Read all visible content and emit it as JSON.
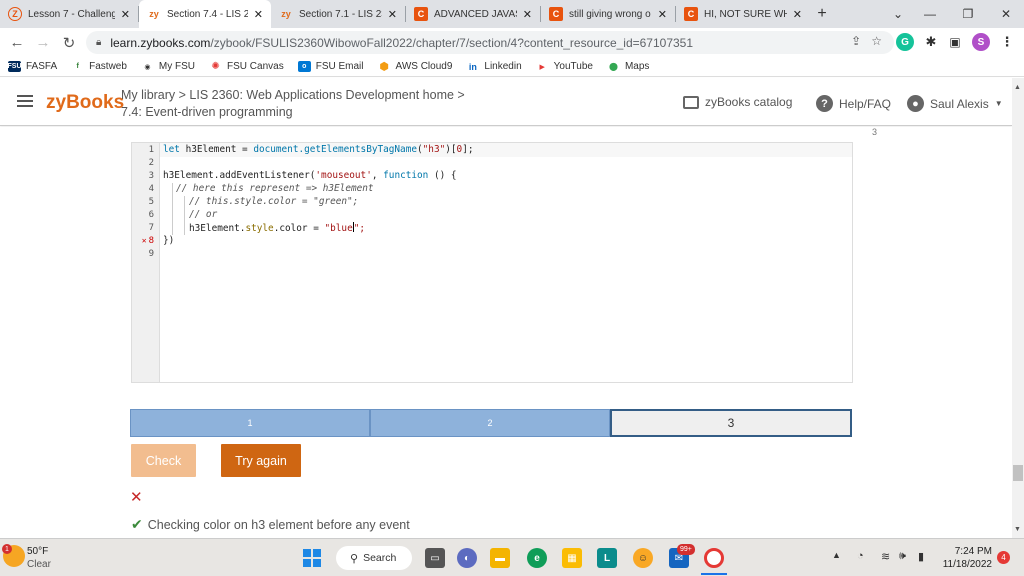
{
  "browser": {
    "tabs": [
      {
        "label": "Lesson 7 - Challeng",
        "icon": "Z",
        "color": "#e8530e"
      },
      {
        "label": "Section 7.4 - LIS 23",
        "icon": "zy",
        "color": "#e06a1a"
      },
      {
        "label": "Section 7.1 - LIS 23",
        "icon": "zy",
        "color": "#e06a1a"
      },
      {
        "label": "ADVANCED JAVASC",
        "icon": "C",
        "color": "#e8530e"
      },
      {
        "label": "still giving wrong o",
        "icon": "C",
        "color": "#e8530e"
      },
      {
        "label": "HI, NOT SURE WHA",
        "icon": "C",
        "color": "#e8530e"
      }
    ],
    "close_glyph": "✕",
    "new_tab": "+",
    "url_main": "learn.zybooks.com",
    "url_rest": "/zybook/FSULIS2360WibowoFall2022/chapter/7/section/4?content_resource_id=67107351",
    "extensions": [
      "G",
      "S"
    ],
    "bookmarks": [
      {
        "label": "FASFA",
        "icon": "FSU"
      },
      {
        "label": "Fastweb",
        "icon": "f"
      },
      {
        "label": "My FSU",
        "icon": "◉"
      },
      {
        "label": "FSU Canvas",
        "icon": "✺"
      },
      {
        "label": "FSU Email",
        "icon": "o"
      },
      {
        "label": "AWS Cloud9",
        "icon": "⬢"
      },
      {
        "label": "Linkedin",
        "icon": "in"
      },
      {
        "label": "YouTube",
        "icon": "▶"
      },
      {
        "label": "Maps",
        "icon": "⬤"
      }
    ]
  },
  "header": {
    "logo": "zyBooks",
    "crumb1": "My library > LIS 2360: Web Applications Development home >",
    "crumb2": "7.4: Event-driven programming",
    "catalog": "zyBooks catalog",
    "help": "Help/FAQ",
    "user": "Saul Alexis"
  },
  "content": {
    "top_number": "3",
    "line_numbers": [
      "1",
      "2",
      "3",
      "4",
      "5",
      "6",
      "7",
      "8",
      "9"
    ],
    "code": {
      "l1_a": "let",
      "l1_b": " h3Element = ",
      "l1_c": "document.getElementsByTagName",
      "l1_d": "(",
      "l1_e": "\"h3\"",
      "l1_f": ")[",
      "l1_g": "0",
      "l1_h": "];",
      "l3_a": "h3Element.addEventListener(",
      "l3_b": "'mouseout'",
      "l3_c": ", ",
      "l3_d": "function",
      "l3_e": " () {",
      "l4": "// here this represent => h3Element",
      "l5": "// this.style.color = \"green\";",
      "l6": "// or",
      "l7_a": "h3Element.",
      "l7_b": "style",
      "l7_c": ".color = ",
      "l7_d": "\"blue",
      "l7_e": "\";",
      "l8": "})"
    },
    "progress": [
      "1",
      "2",
      "3"
    ],
    "check_label": "Check",
    "try_label": "Try again",
    "x_mark": "✕",
    "result_msg": "Checking color on h3 element before any event"
  },
  "taskbar": {
    "temp": "50°F",
    "condition": "Clear",
    "weather_badge": "1",
    "search_label": "Search",
    "mail_badge": "99+",
    "time": "7:24 PM",
    "date": "11/18/2022",
    "notif_count": "4"
  }
}
